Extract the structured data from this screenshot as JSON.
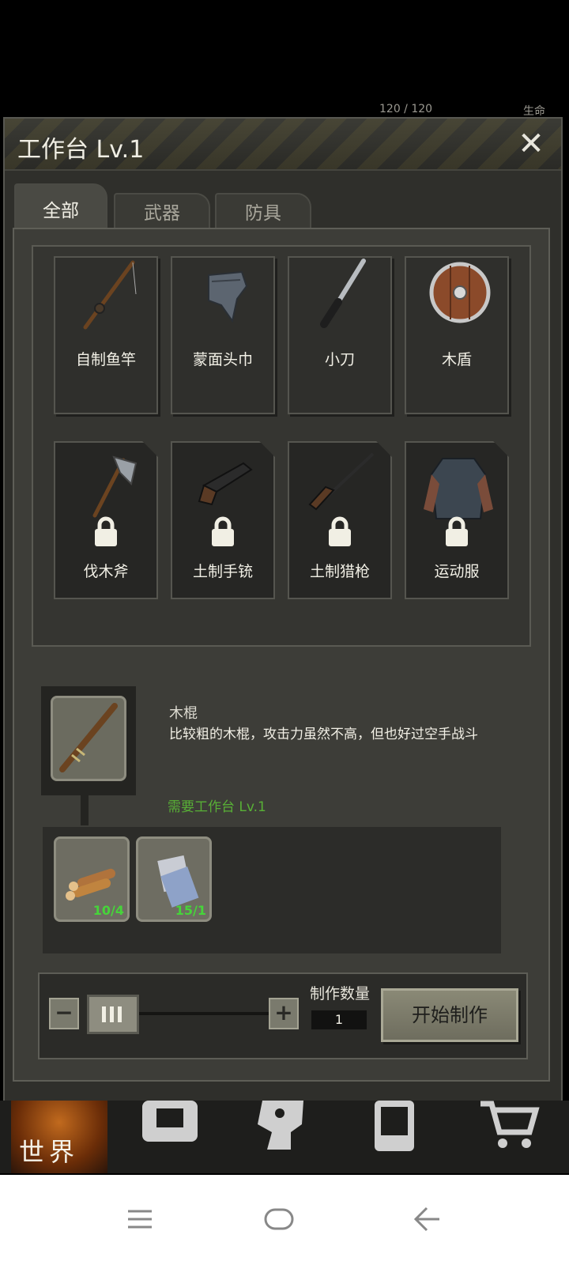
{
  "status_peek": {
    "hp": "120 / 120",
    "life": "生命"
  },
  "window": {
    "title": "工作台 Lv.1",
    "close_icon": "close-icon"
  },
  "tabs": [
    {
      "label": "全部",
      "active": true
    },
    {
      "label": "武器",
      "active": false
    },
    {
      "label": "防具",
      "active": false
    }
  ],
  "items": [
    {
      "name": "自制鱼竿",
      "icon": "fishing-rod-icon",
      "locked": false
    },
    {
      "name": "蒙面头巾",
      "icon": "bandana-icon",
      "locked": false
    },
    {
      "name": "小刀",
      "icon": "knife-icon",
      "locked": false
    },
    {
      "name": "木盾",
      "icon": "wooden-shield-icon",
      "locked": false
    },
    {
      "name": "伐木斧",
      "icon": "axe-icon",
      "locked": true
    },
    {
      "name": "土制手铳",
      "icon": "pistol-icon",
      "locked": true
    },
    {
      "name": "土制猎枪",
      "icon": "rifle-icon",
      "locked": true
    },
    {
      "name": "运动服",
      "icon": "jacket-icon",
      "locked": true
    }
  ],
  "detail": {
    "name": "木棍",
    "description": "比较粗的木棍，攻击力虽然不高，但也好过空手战斗",
    "requirement": "需要工作台 Lv.1",
    "icon": "wooden-stick-icon",
    "materials": [
      {
        "icon": "wood-logs-icon",
        "count": "10/4"
      },
      {
        "icon": "cloth-icon",
        "count": "15/1"
      }
    ]
  },
  "craft": {
    "quantity_label": "制作数量",
    "quantity": "1",
    "start_label": "开始制作"
  },
  "bottom_nav": {
    "world_label": "世界"
  },
  "colors": {
    "requirement_green": "#58b036",
    "material_count_green": "#46d43a"
  }
}
